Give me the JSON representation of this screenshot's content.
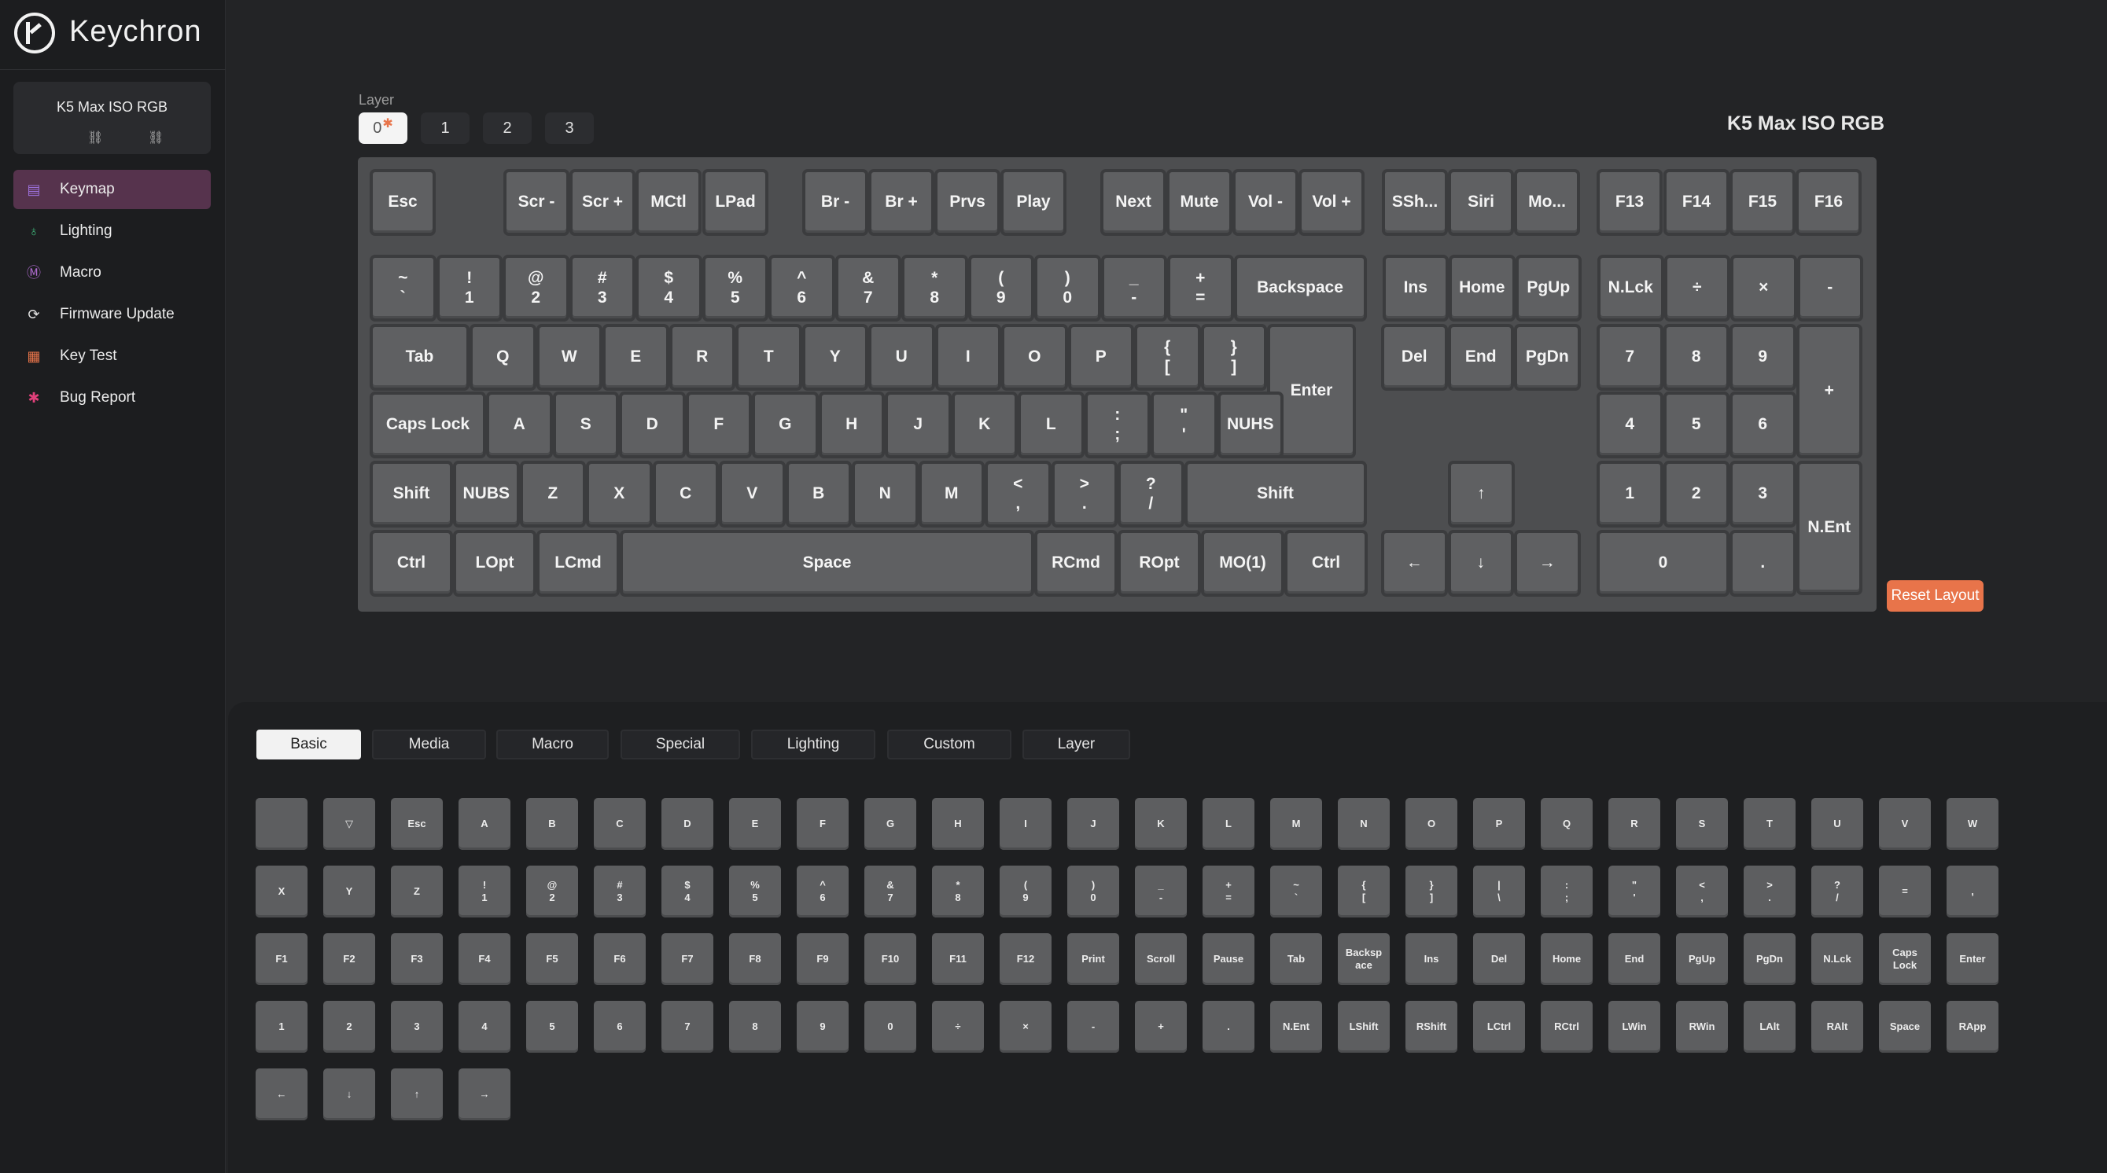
{
  "app": {
    "brand": "Keychron"
  },
  "device": {
    "name": "K5 Max ISO RGB"
  },
  "nav": [
    {
      "label": "Keymap",
      "icon": "keyboard-icon",
      "color": "#9a6fd6",
      "active": true
    },
    {
      "label": "Lighting",
      "icon": "bulb-icon",
      "color": "#3fb57a",
      "active": false
    },
    {
      "label": "Macro",
      "icon": "macro-m-icon",
      "color": "#b06bd0",
      "active": false
    },
    {
      "label": "Firmware Update",
      "icon": "firmware-update-icon",
      "color": "#e0e0e0",
      "active": false
    },
    {
      "label": "Key Test",
      "icon": "key-test-icon",
      "color": "#e8744a",
      "active": false
    },
    {
      "label": "Bug Report",
      "icon": "bug-icon",
      "color": "#e0407a",
      "active": false
    }
  ],
  "layers": {
    "label": "Layer",
    "items": [
      "0",
      "1",
      "2",
      "3"
    ],
    "active": 0
  },
  "keyboard": {
    "title": "K5 Max ISO RGB",
    "rows": {
      "fn": [
        "Esc",
        "Scr -",
        "Scr +",
        "MCtl",
        "LPad",
        "Br -",
        "Br +",
        "Prvs",
        "Play",
        "Next",
        "Mute",
        "Vol -",
        "Vol +",
        "SSh...",
        "Siri",
        "Mo...",
        "F13",
        "F14",
        "F15",
        "F16"
      ],
      "num": [
        "~\n`",
        "!\n1",
        "@\n2",
        "#\n3",
        "$\n4",
        "%\n5",
        "^\n6",
        "&\n7",
        "*\n8",
        "(\n9",
        ")\n0",
        "_\n-",
        "+\n=",
        "Backspace",
        "Ins",
        "Home",
        "PgUp",
        "N.Lck",
        "÷",
        "×",
        "-"
      ],
      "top": [
        "Tab",
        "Q",
        "W",
        "E",
        "R",
        "T",
        "Y",
        "U",
        "I",
        "O",
        "P",
        "{\n[",
        "}\n]",
        "Enter",
        "Del",
        "End",
        "PgDn",
        "7",
        "8",
        "9",
        "+"
      ],
      "home": [
        "Caps Lock",
        "A",
        "S",
        "D",
        "F",
        "G",
        "H",
        "J",
        "K",
        "L",
        ":\n;",
        "\"\n'",
        "NUHS",
        "4",
        "5",
        "6"
      ],
      "shift": [
        "Shift",
        "NUBS",
        "Z",
        "X",
        "C",
        "V",
        "B",
        "N",
        "M",
        "<\n,",
        ">\n.",
        "?\n/",
        "Shift",
        "↑",
        "1",
        "2",
        "3",
        "N.Ent"
      ],
      "bottom": [
        "Ctrl",
        "LOpt",
        "LCmd",
        "Space",
        "RCmd",
        "ROpt",
        "MO(1)",
        "Ctrl",
        "←",
        "↓",
        "→",
        "0",
        "."
      ]
    }
  },
  "reset_label": "Reset Layout",
  "palette": {
    "tabs": [
      "Basic",
      "Media",
      "Macro",
      "Special",
      "Lighting",
      "Custom",
      "Layer"
    ],
    "active_tab": 0,
    "rows": [
      [
        "",
        "▽",
        "Esc",
        "A",
        "B",
        "C",
        "D",
        "E",
        "F",
        "G",
        "H",
        "I",
        "J",
        "K",
        "L",
        "M",
        "N",
        "O",
        "P",
        "Q",
        "R",
        "S",
        "T",
        "U",
        "V",
        "W"
      ],
      [
        "X",
        "Y",
        "Z",
        "!\n1",
        "@\n2",
        "#\n3",
        "$\n4",
        "%\n5",
        "^\n6",
        "&\n7",
        "*\n8",
        "(\n9",
        ")\n0",
        "_\n-",
        "+\n=",
        "~\n`",
        "{\n[",
        "}\n]",
        "|\n\\",
        ":\n;",
        "\"\n'",
        "<\n,",
        ">\n.",
        "?\n/",
        "=",
        ","
      ],
      [
        "F1",
        "F2",
        "F3",
        "F4",
        "F5",
        "F6",
        "F7",
        "F8",
        "F9",
        "F10",
        "F11",
        "F12",
        "Print",
        "Scroll",
        "Pause",
        "Tab",
        "Backsp\nace",
        "Ins",
        "Del",
        "Home",
        "End",
        "PgUp",
        "PgDn",
        "N.Lck",
        "Caps\nLock",
        "Enter"
      ],
      [
        "1",
        "2",
        "3",
        "4",
        "5",
        "6",
        "7",
        "8",
        "9",
        "0",
        "÷",
        "×",
        "-",
        "+",
        ".",
        "N.Ent",
        "LShift",
        "RShift",
        "LCtrl",
        "RCtrl",
        "LWin",
        "RWin",
        "LAlt",
        "RAlt",
        "Space",
        "RApp"
      ],
      [
        "←",
        "↓",
        "↑",
        "→"
      ]
    ]
  },
  "colors": {
    "accent": "#e8744a",
    "nav_active": "#56334d"
  }
}
